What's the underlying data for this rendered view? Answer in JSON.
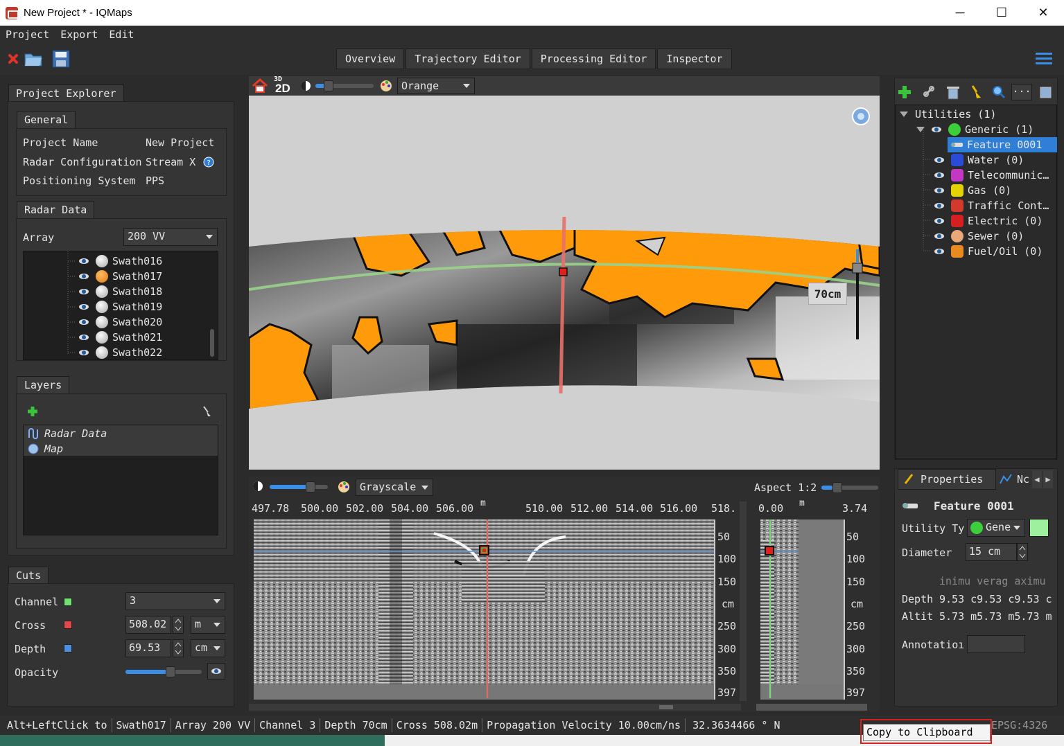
{
  "window": {
    "title": "New Project * - IQMaps",
    "minimize": "─",
    "maximize": "☐",
    "close": "✕"
  },
  "menu": [
    "Project",
    "Export",
    "Edit"
  ],
  "tabs": [
    "Overview",
    "Trajectory Editor",
    "Processing Editor",
    "Inspector"
  ],
  "project_explorer": {
    "title": "Project Explorer",
    "general": {
      "title": "General",
      "project_name_label": "Project Name",
      "project_name_value": "New Project",
      "radar_config_label": "Radar Configuration",
      "radar_config_value": "Stream X",
      "positioning_label": "Positioning System",
      "positioning_value": "PPS"
    },
    "radar_data": {
      "title": "Radar Data",
      "array_label": "Array",
      "array_value": "200 VV",
      "swaths": [
        "Swath016",
        "Swath017",
        "Swath018",
        "Swath019",
        "Swath020",
        "Swath021",
        "Swath022"
      ],
      "selected_swath": "Swath017"
    },
    "layers": {
      "title": "Layers",
      "items": [
        "Radar Data",
        "Map"
      ]
    },
    "cuts": {
      "title": "Cuts",
      "channel_label": "Channel",
      "channel_value": "3",
      "cross_label": "Cross",
      "cross_value": "508.02",
      "cross_unit": "m",
      "depth_label": "Depth",
      "depth_value": "69.53",
      "depth_unit": "cm",
      "opacity_label": "Opacity",
      "opacity_level": 0.6
    }
  },
  "map_view": {
    "mode_label": "2D",
    "mode_super": "3D",
    "palette": "Orange",
    "depth_badge": "70cm"
  },
  "radar_view": {
    "palette": "Grayscale",
    "aspect_label": "Aspect 1:2",
    "x_ticks": [
      "497.78",
      "500.00",
      "502.00",
      "504.00",
      "506.00",
      "m",
      "510.00",
      "512.00",
      "514.00",
      "516.00",
      "518."
    ],
    "y_ticks": [
      "50",
      "100",
      "150",
      "cm",
      "250",
      "300",
      "350",
      "397"
    ],
    "side_x_ticks": [
      "0.00",
      "m",
      "3.74"
    ],
    "side_y_ticks": [
      "50",
      "100",
      "150",
      "cm",
      "250",
      "300",
      "350",
      "397"
    ]
  },
  "utilities": {
    "root": "Utilities (1)",
    "items": [
      {
        "label": "Generic (1)",
        "color": "#3ccf3c"
      },
      {
        "label": "Water (0)",
        "color": "#2a4bd7"
      },
      {
        "label": "Telecommunic…",
        "color": "#c238c2"
      },
      {
        "label": "Gas (0)",
        "color": "#e3d100"
      },
      {
        "label": "Traffic Cont…",
        "color": "#d4392d"
      },
      {
        "label": "Electric (0)",
        "color": "#d42020"
      },
      {
        "label": "Sewer (0)",
        "color": "#e8a878"
      },
      {
        "label": "Fuel/Oil (0)",
        "color": "#e88a20"
      }
    ],
    "feature": "Feature 0001"
  },
  "properties": {
    "tab": "Properties",
    "tab2": "Nc",
    "title": "Feature 0001",
    "utility_type_label": "Utility Ty",
    "utility_type_value": "Gene",
    "diameter_label": "Diameter",
    "diameter_value": "15 cm",
    "stats_header": "inimu verag aximu",
    "depth_label": "Depth",
    "depth_values": "9.53 c9.53 c9.53 c",
    "altitude_label": "Altit",
    "altitude_values": "5.73 m5.73 m5.73 m",
    "annotation_label": "Annotatioı",
    "swatch_color": "#9ef09e"
  },
  "status": {
    "hint": "Alt+LeftClick to",
    "swath": "Swath017",
    "array": "Array 200 VV",
    "channel": "Channel   3",
    "depth": "Depth     70cm",
    "cross": "Cross     508.02m",
    "velocity": "Propagation Velocity 10.00cm/ns",
    "coords": "32.3634466 ° N",
    "epsg": "EPSG:4326"
  },
  "tooltip": "Copy to Clipboard",
  "colors": {
    "accent": "#3a8ee6",
    "orange": "#ff9a0a",
    "selection": "#2f7fd6"
  }
}
